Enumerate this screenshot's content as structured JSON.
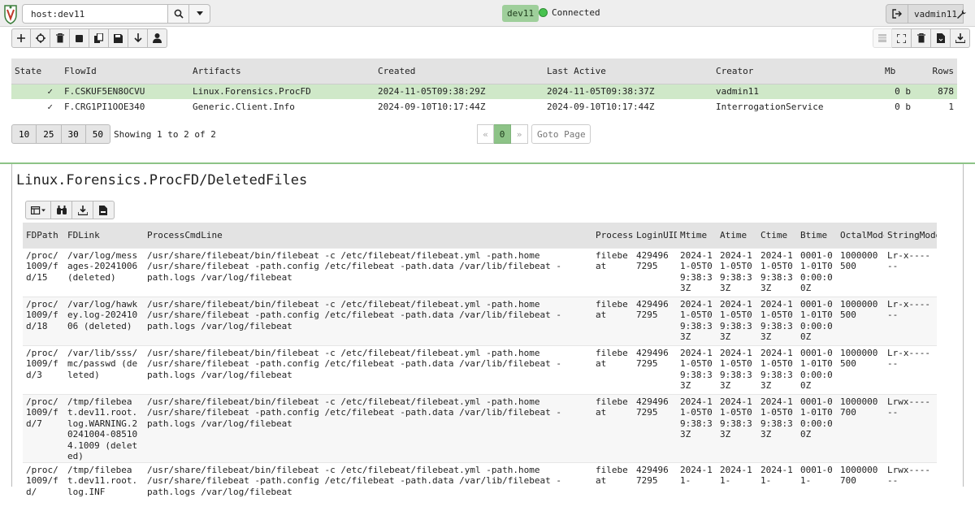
{
  "navbar": {
    "search_value": "host:dev11",
    "client_id": "dev11",
    "status": "Connected",
    "username": "vadmin11",
    "status_color": "#48c24f",
    "accent": "#9fcf9b"
  },
  "flows_table": {
    "columns": [
      "State",
      "FlowId",
      "Artifacts",
      "Created",
      "Last Active",
      "Creator",
      "Mb",
      "Rows"
    ],
    "rows": [
      {
        "state": "✓",
        "flow_id": "F.CSKUF5EN8OCVU",
        "artifacts": "Linux.Forensics.ProcFD",
        "created": "2024-11-05T09:38:29Z",
        "last_active": "2024-11-05T09:38:37Z",
        "creator": "vadmin11",
        "mb": "0 b",
        "rows": "878"
      },
      {
        "state": "✓",
        "flow_id": "F.CRG1PI1OOE340",
        "artifacts": "Generic.Client.Info",
        "created": "2024-09-10T10:17:44Z",
        "last_active": "2024-09-10T10:17:44Z",
        "creator": "InterrogationService",
        "mb": "0 b",
        "rows": "1"
      }
    ]
  },
  "pagination": {
    "sizes": [
      "10",
      "25",
      "30",
      "50"
    ],
    "showing": "Showing 1 to 2 of 2",
    "prev": "«",
    "current": "0",
    "next": "»",
    "goto_placeholder": "Goto Page"
  },
  "results": {
    "title": "Linux.Forensics.ProcFD/DeletedFiles",
    "columns": [
      "FDPath",
      "FDLink",
      "ProcessCmdLine",
      "Process",
      "LoginUID",
      "Mtime",
      "Atime",
      "Ctime",
      "Btime",
      "OctalMode",
      "StringMode"
    ],
    "rows": [
      {
        "fdpath": "/proc/1009/fd/15",
        "fdlink": "/var/log/messages-20241006 (deleted)",
        "cmdline": "/usr/share/filebeat/bin/filebeat -c /etc/filebeat/filebeat.yml -path.home /usr/share/filebeat -path.config /etc/filebeat -path.data /var/lib/filebeat -path.logs /var/log/filebeat",
        "process": "filebeat",
        "loginuid": "4294967295",
        "mtime": "2024-11-05T09:38:33Z",
        "atime": "2024-11-05T09:38:33Z",
        "ctime": "2024-11-05T09:38:33Z",
        "btime": "0001-01-01T00:00:00Z",
        "octal": "1000000500",
        "stringmode": "Lr-x------"
      },
      {
        "fdpath": "/proc/1009/fd/18",
        "fdlink": "/var/log/hawkey.log-20241006 (deleted)",
        "cmdline": "/usr/share/filebeat/bin/filebeat -c /etc/filebeat/filebeat.yml -path.home /usr/share/filebeat -path.config /etc/filebeat -path.data /var/lib/filebeat -path.logs /var/log/filebeat",
        "process": "filebeat",
        "loginuid": "4294967295",
        "mtime": "2024-11-05T09:38:33Z",
        "atime": "2024-11-05T09:38:33Z",
        "ctime": "2024-11-05T09:38:33Z",
        "btime": "0001-01-01T00:00:00Z",
        "octal": "1000000500",
        "stringmode": "Lr-x------"
      },
      {
        "fdpath": "/proc/1009/fd/3",
        "fdlink": "/var/lib/sss/mc/passwd (deleted)",
        "cmdline": "/usr/share/filebeat/bin/filebeat -c /etc/filebeat/filebeat.yml -path.home /usr/share/filebeat -path.config /etc/filebeat -path.data /var/lib/filebeat -path.logs /var/log/filebeat",
        "process": "filebeat",
        "loginuid": "4294967295",
        "mtime": "2024-11-05T09:38:33Z",
        "atime": "2024-11-05T09:38:33Z",
        "ctime": "2024-11-05T09:38:33Z",
        "btime": "0001-01-01T00:00:00Z",
        "octal": "1000000500",
        "stringmode": "Lr-x------"
      },
      {
        "fdpath": "/proc/1009/fd/7",
        "fdlink": "/tmp/filebeat.dev11.root.log.WARNING.20241004-085104.1009 (deleted)",
        "cmdline": "/usr/share/filebeat/bin/filebeat -c /etc/filebeat/filebeat.yml -path.home /usr/share/filebeat -path.config /etc/filebeat -path.data /var/lib/filebeat -path.logs /var/log/filebeat",
        "process": "filebeat",
        "loginuid": "4294967295",
        "mtime": "2024-11-05T09:38:33Z",
        "atime": "2024-11-05T09:38:33Z",
        "ctime": "2024-11-05T09:38:33Z",
        "btime": "0001-01-01T00:00:00Z",
        "octal": "1000000700",
        "stringmode": "Lrwx------"
      },
      {
        "fdpath": "/proc/1009/fd/",
        "fdlink": "/tmp/filebeat.dev11.root.log.INF",
        "cmdline": "/usr/share/filebeat/bin/filebeat -c /etc/filebeat/filebeat.yml -path.home /usr/share/filebeat -path.config /etc/filebeat -path.data /var/lib/filebeat -path.logs /var/log/filebeat",
        "process": "filebeat",
        "loginuid": "4294967295",
        "mtime": "2024-11-",
        "atime": "2024-11-",
        "ctime": "2024-11-",
        "btime": "0001-01-",
        "octal": "1000000700",
        "stringmode": "Lrwx------"
      }
    ]
  }
}
